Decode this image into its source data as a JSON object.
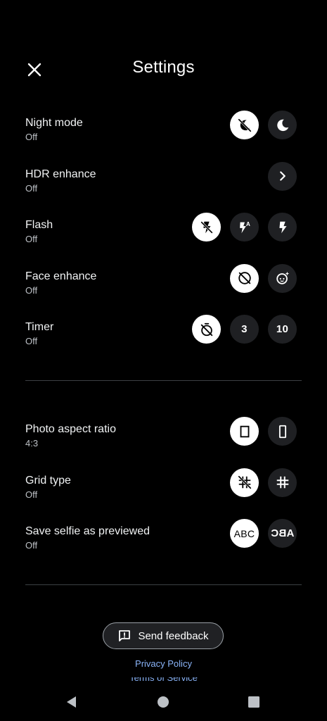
{
  "header": {
    "title": "Settings",
    "close_icon": "close-icon"
  },
  "settings_primary": [
    {
      "label": "Night mode",
      "value": "Off"
    },
    {
      "label": "HDR enhance",
      "value": "Off"
    },
    {
      "label": "Flash",
      "value": "Off"
    },
    {
      "label": "Face enhance",
      "value": "Off"
    },
    {
      "label": "Timer",
      "value": "Off",
      "options": [
        "3",
        "10"
      ]
    }
  ],
  "settings_secondary": [
    {
      "label": "Photo aspect ratio",
      "value": "4:3"
    },
    {
      "label": "Grid type",
      "value": "Off"
    },
    {
      "label": "Save selfie as previewed",
      "value": "Off",
      "options": [
        "ABC",
        "ABC"
      ]
    }
  ],
  "footer": {
    "feedback_label": "Send feedback",
    "privacy_label": "Privacy Policy",
    "terms_label": "Terms of Service"
  },
  "colors": {
    "background": "#000000",
    "selected": "#ffffff",
    "unselected": "#1f2023",
    "link": "#8ab4f8"
  }
}
